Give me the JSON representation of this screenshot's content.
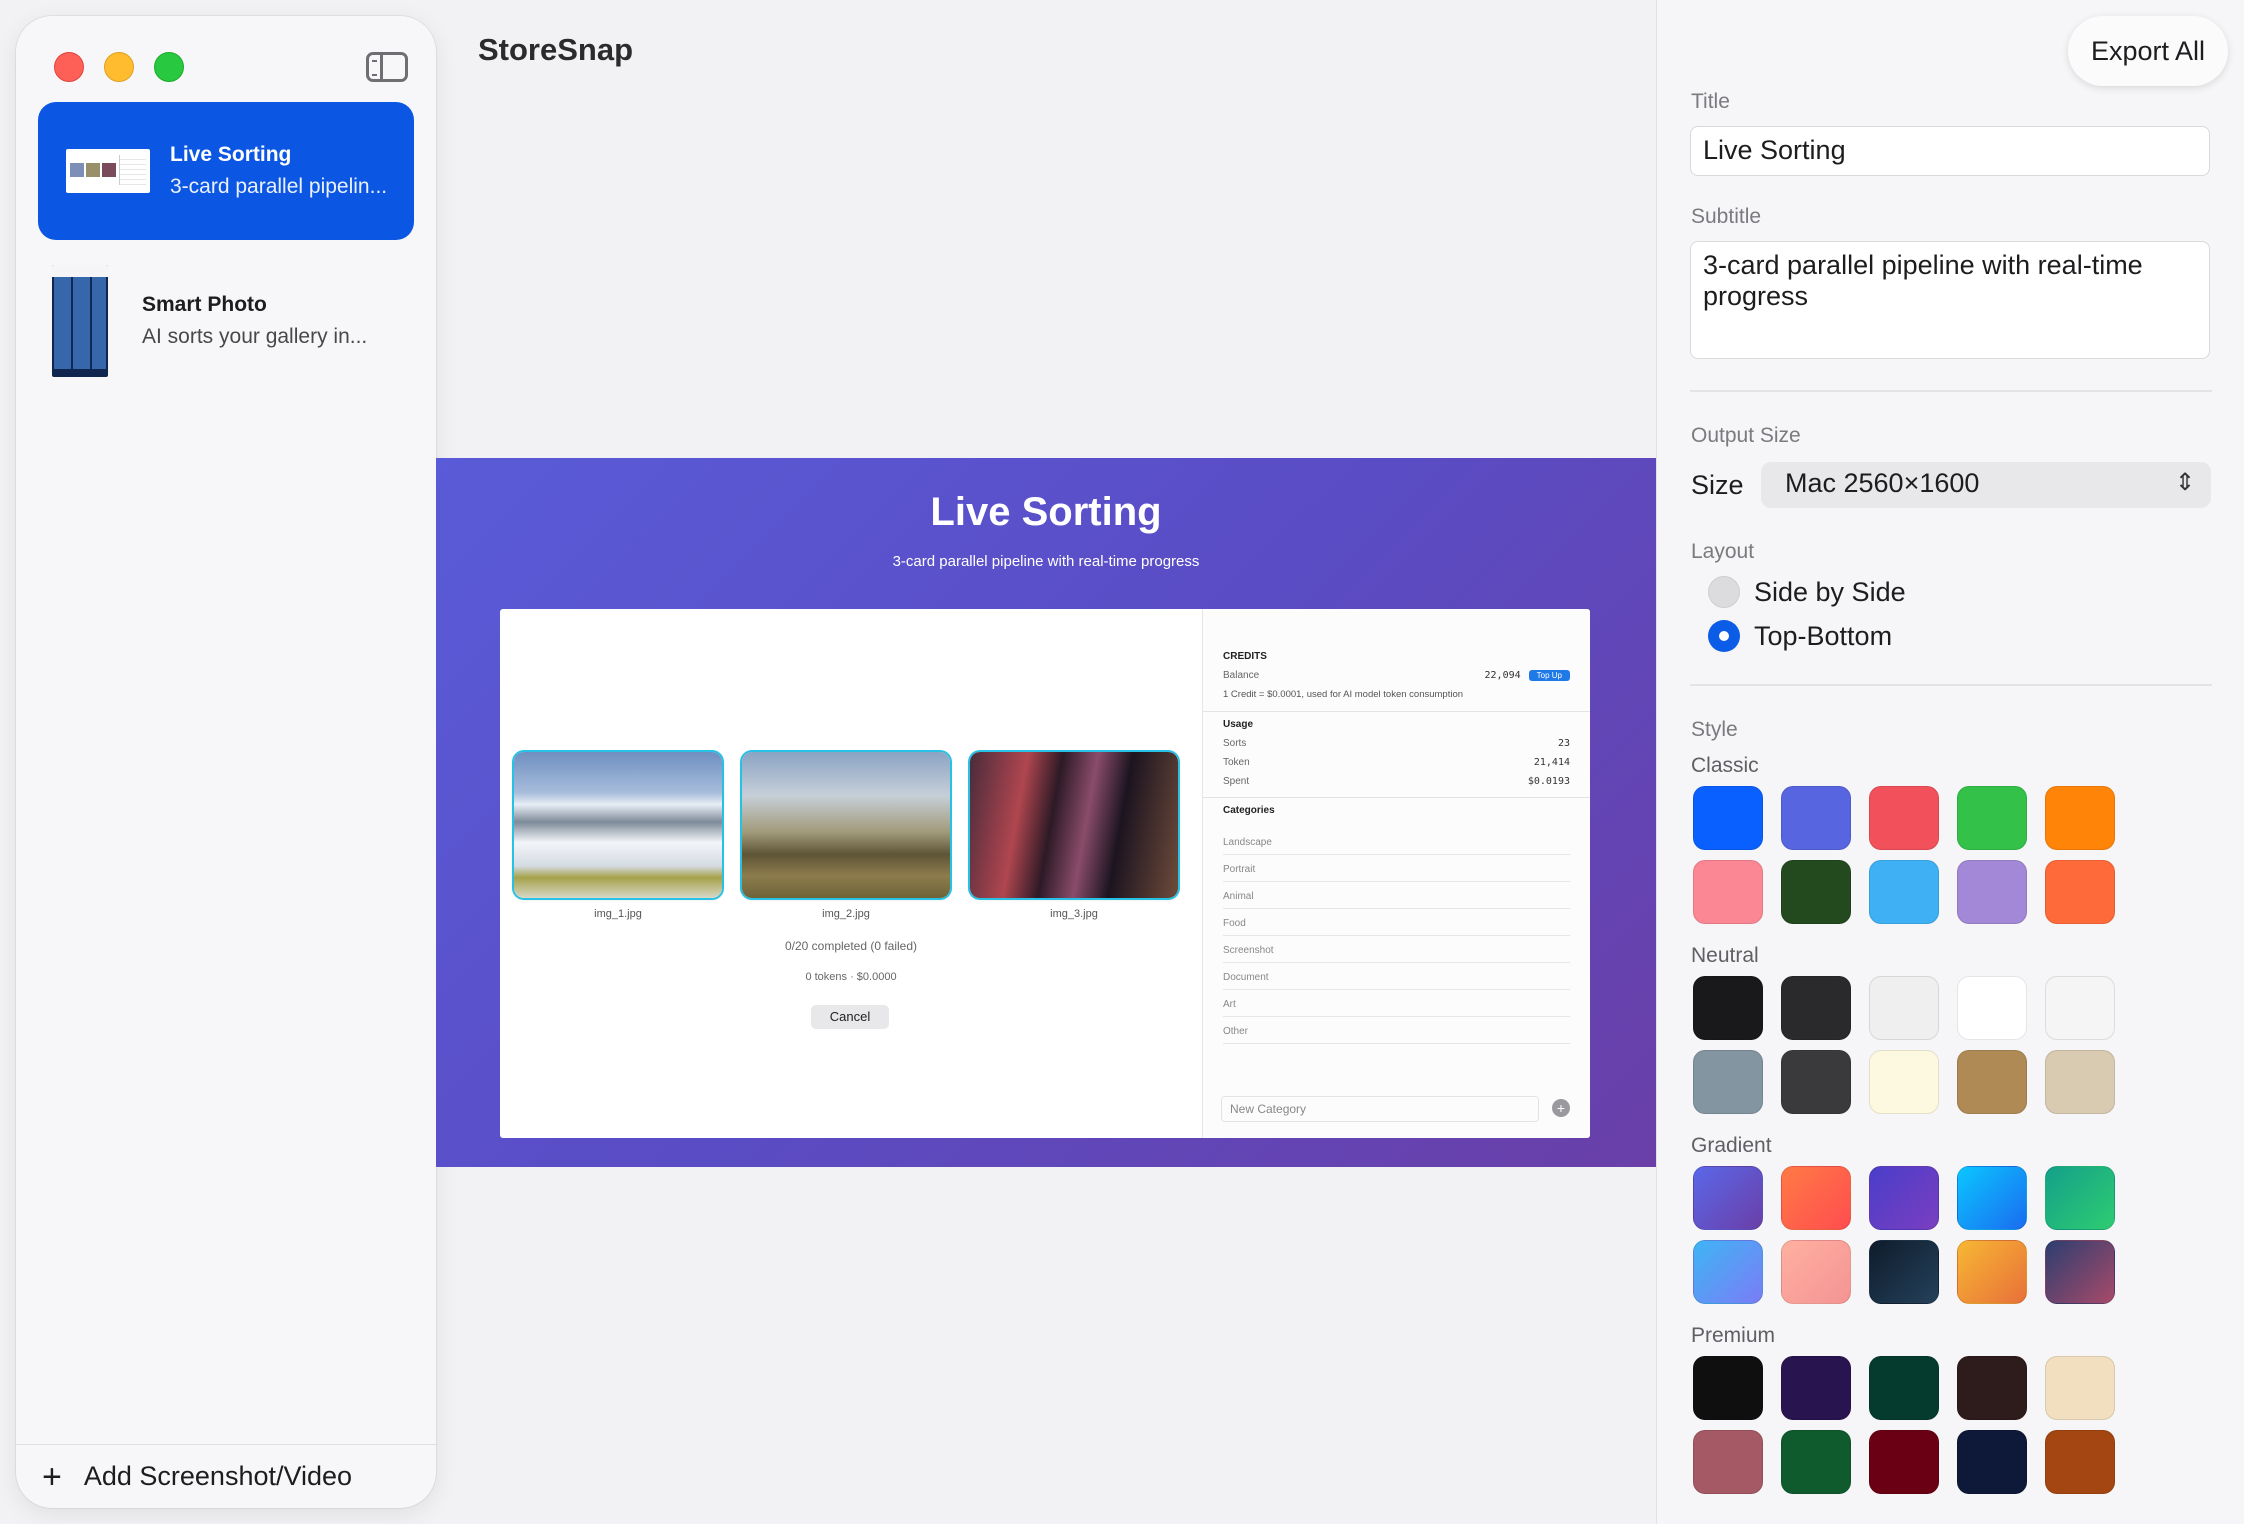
{
  "app": {
    "title": "StoreSnap",
    "export_label": "Export All"
  },
  "sidebar": {
    "items": [
      {
        "title": "Live Sorting",
        "subtitle": "3-card parallel pipelin..."
      },
      {
        "title": "Smart Photo",
        "subtitle": "AI sorts your gallery in..."
      }
    ],
    "add_label": "Add Screenshot/Video",
    "add_icon": "plus-icon"
  },
  "preview": {
    "title": "Live Sorting",
    "subtitle": "3-card parallel pipeline with real-time progress",
    "cards": [
      {
        "caption": "img_1.jpg"
      },
      {
        "caption": "img_2.jpg"
      },
      {
        "caption": "img_3.jpg"
      }
    ],
    "status": "0/20 completed (0 failed)",
    "tokens": "0 tokens · $0.0000",
    "cancel": "Cancel",
    "credits": {
      "heading": "CREDITS",
      "balance_label": "Balance",
      "balance_value": "22,094",
      "topup": "Top Up",
      "note": "1 Credit = $0.0001, used for AI model token consumption"
    },
    "usage": {
      "heading": "Usage",
      "rows": [
        {
          "label": "Sorts",
          "value": "23"
        },
        {
          "label": "Token",
          "value": "21,414"
        },
        {
          "label": "Spent",
          "value": "$0.0193"
        }
      ]
    },
    "categories": {
      "heading": "Categories",
      "items": [
        "Landscape",
        "Portrait",
        "Animal",
        "Food",
        "Screenshot",
        "Document",
        "Art",
        "Other"
      ],
      "new_placeholder": "New Category"
    }
  },
  "panel": {
    "title_label": "Title",
    "title_value": "Live Sorting",
    "subtitle_label": "Subtitle",
    "subtitle_value": "3-card parallel pipeline with real-time progress",
    "output_label": "Output Size",
    "size_label": "Size",
    "size_value": "Mac 2560×1600",
    "layout_label": "Layout",
    "layout_options": [
      {
        "label": "Side by Side",
        "selected": false
      },
      {
        "label": "Top-Bottom",
        "selected": true
      }
    ],
    "style_label": "Style",
    "groups": [
      {
        "name": "Classic",
        "colors": [
          "#0a60ff",
          "#5865e0",
          "#f2505a",
          "#33c14a",
          "#ff8408",
          "#fb8795",
          "#234a1e",
          "#3eb0f3",
          "#a288d6",
          "#ff6a3a"
        ]
      },
      {
        "name": "Neutral",
        "colors": [
          "#19191b",
          "#2a2a2c",
          "#efefef",
          "#ffffff",
          "#f5f5f5",
          "#8395a1",
          "#3a3a3c",
          "#fdf9e0",
          "#b08a55",
          "#d8cbb2"
        ]
      },
      {
        "name": "Gradient",
        "colors": [
          "#5a55d0",
          "#ff5a49",
          "#5e38c2",
          "#1593f3",
          "#21a56b",
          "#5aa0fa",
          "#f8a0a0",
          "#1a2a3c",
          "#f0a034",
          "#5a4070"
        ]
      },
      {
        "name": "Premium",
        "colors": [
          "#0f0f10",
          "#28154f",
          "#053a2e",
          "#2e1b1b",
          "#f2dfbf",
          "#a55965",
          "#0f5b2e",
          "#6a0014",
          "#0e1838",
          "#a34611"
        ]
      }
    ]
  }
}
